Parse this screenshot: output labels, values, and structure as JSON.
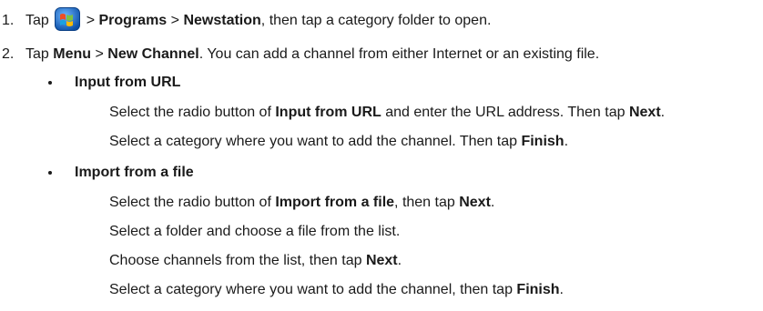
{
  "steps": [
    {
      "number": "1.",
      "parts": [
        "Tap",
        ">",
        "Programs",
        ">",
        "Newstation",
        ", then tap a category folder to open."
      ],
      "icon": "windows-start-icon"
    },
    {
      "number": "2.",
      "parts": [
        "Tap",
        "Menu",
        ">",
        "New Channel",
        ". You can add a channel from either Internet or an existing file."
      ]
    }
  ],
  "sections": [
    {
      "heading": "Input from URL",
      "lines": [
        [
          "Select the radio button of",
          "Input from URL",
          "and enter the URL address. Then tap",
          "Next",
          "."
        ],
        [
          "Select a category where you want to add the channel. Then tap",
          "Finish",
          "."
        ]
      ]
    },
    {
      "heading": "Import from a file",
      "lines": [
        [
          "Select the radio button of",
          "Import from a file",
          ", then tap",
          "Next",
          "."
        ],
        [
          "Select a folder and choose a file from the list."
        ],
        [
          "Choose channels from the list, then tap",
          "Next",
          "."
        ],
        [
          "Select a category where you want to add the channel, then tap",
          "Finish",
          "."
        ]
      ]
    }
  ]
}
